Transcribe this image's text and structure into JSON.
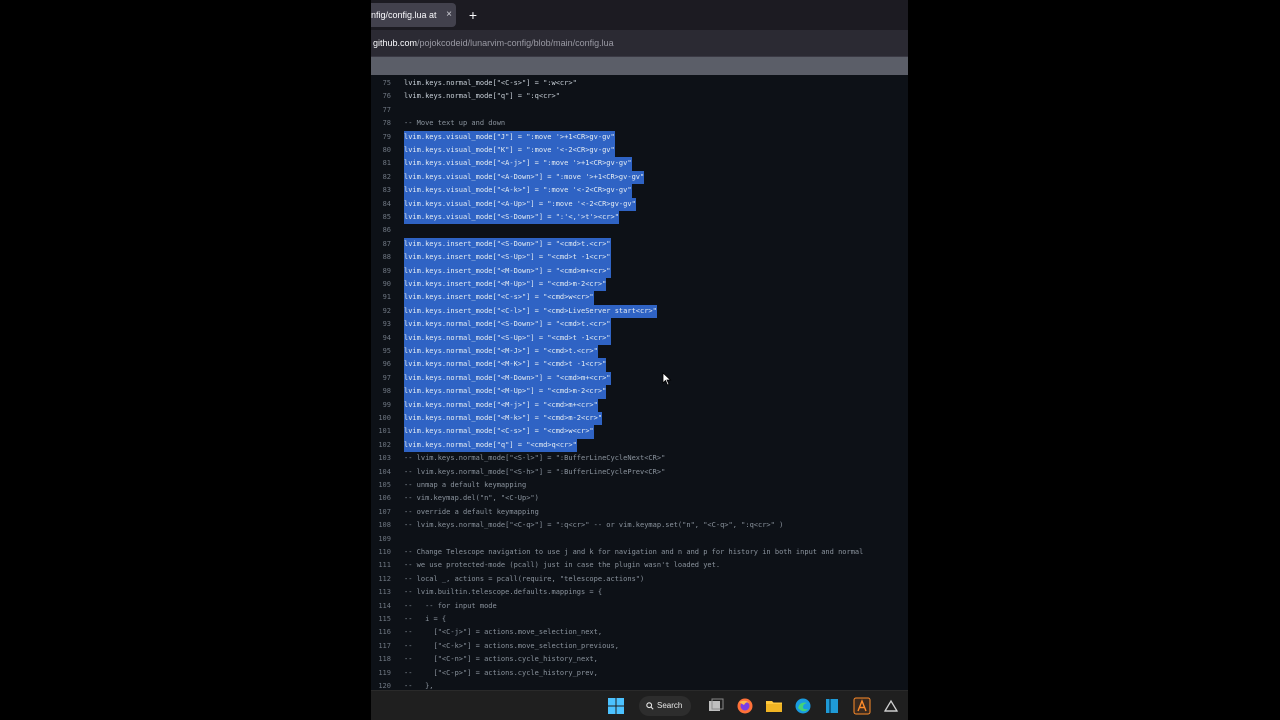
{
  "browser": {
    "tab_title": "nfig/config.lua at",
    "tab_close": "×",
    "new_tab": "+",
    "url_host": "github.com",
    "url_path": "/pojokcodeid/lunarvim-config/blob/main/config.lua"
  },
  "code": {
    "lines": [
      {
        "n": "75",
        "text": "lvim.keys.normal_mode[\"<C-s>\"] = \":w<cr>\"",
        "kind": "code"
      },
      {
        "n": "76",
        "text": "lvim.keys.normal_mode[\"q\"] = \":q<cr>\"",
        "kind": "code"
      },
      {
        "n": "77",
        "text": "",
        "kind": "code"
      },
      {
        "n": "78",
        "text": "-- Move text up and down",
        "kind": "comment"
      },
      {
        "n": "79",
        "text": "lvim.keys.visual_mode[\"J\"] = \":move '>+1<CR>gv-gv\"",
        "kind": "selected"
      },
      {
        "n": "80",
        "text": "lvim.keys.visual_mode[\"K\"] = \":move '<-2<CR>gv-gv\"",
        "kind": "selected"
      },
      {
        "n": "81",
        "text": "lvim.keys.visual_mode[\"<A-j>\"] = \":move '>+1<CR>gv-gv\"",
        "kind": "selected"
      },
      {
        "n": "82",
        "text": "lvim.keys.visual_mode[\"<A-Down>\"] = \":move '>+1<CR>gv-gv\"",
        "kind": "selected"
      },
      {
        "n": "83",
        "text": "lvim.keys.visual_mode[\"<A-k>\"] = \":move '<-2<CR>gv-gv\"",
        "kind": "selected"
      },
      {
        "n": "84",
        "text": "lvim.keys.visual_mode[\"<A-Up>\"] = \":move '<-2<CR>gv-gv\"",
        "kind": "selected"
      },
      {
        "n": "85",
        "text": "lvim.keys.visual_mode[\"<S-Down>\"] = \":'<,'>t'><cr>\"",
        "kind": "selected"
      },
      {
        "n": "86",
        "text": "",
        "kind": "code"
      },
      {
        "n": "87",
        "text": "lvim.keys.insert_mode[\"<S-Down>\"] = \"<cmd>t.<cr>\"",
        "kind": "selected"
      },
      {
        "n": "88",
        "text": "lvim.keys.insert_mode[\"<S-Up>\"] = \"<cmd>t -1<cr>\"",
        "kind": "selected"
      },
      {
        "n": "89",
        "text": "lvim.keys.insert_mode[\"<M-Down>\"] = \"<cmd>m+<cr>\"",
        "kind": "selected"
      },
      {
        "n": "90",
        "text": "lvim.keys.insert_mode[\"<M-Up>\"] = \"<cmd>m-2<cr>\"",
        "kind": "selected"
      },
      {
        "n": "91",
        "text": "lvim.keys.insert_mode[\"<C-s>\"] = \"<cmd>w<cr>\"",
        "kind": "selected"
      },
      {
        "n": "92",
        "text": "lvim.keys.insert_mode[\"<C-l>\"] = \"<cmd>LiveServer start<cr>\"",
        "kind": "selected"
      },
      {
        "n": "93",
        "text": "lvim.keys.normal_mode[\"<S-Down>\"] = \"<cmd>t.<cr>\"",
        "kind": "selected"
      },
      {
        "n": "94",
        "text": "lvim.keys.normal_mode[\"<S-Up>\"] = \"<cmd>t -1<cr>\"",
        "kind": "selected"
      },
      {
        "n": "95",
        "text": "lvim.keys.normal_mode[\"<M-J>\"] = \"<cmd>t.<cr>\"",
        "kind": "selected"
      },
      {
        "n": "96",
        "text": "lvim.keys.normal_mode[\"<M-K>\"] = \"<cmd>t -1<cr>\"",
        "kind": "selected"
      },
      {
        "n": "97",
        "text": "lvim.keys.normal_mode[\"<M-Down>\"] = \"<cmd>m+<cr>\"",
        "kind": "selected"
      },
      {
        "n": "98",
        "text": "lvim.keys.normal_mode[\"<M-Up>\"] = \"<cmd>m-2<cr>\"",
        "kind": "selected"
      },
      {
        "n": "99",
        "text": "lvim.keys.normal_mode[\"<M-j>\"] = \"<cmd>m+<cr>\"",
        "kind": "selected"
      },
      {
        "n": "100",
        "text": "lvim.keys.normal_mode[\"<M-k>\"] = \"<cmd>m-2<cr>\"",
        "kind": "selected"
      },
      {
        "n": "101",
        "text": "lvim.keys.normal_mode[\"<C-s>\"] = \"<cmd>w<cr>\"",
        "kind": "selected"
      },
      {
        "n": "102",
        "text": "lvim.keys.normal_mode[\"q\"] = \"<cmd>q<cr>\"",
        "kind": "selected"
      },
      {
        "n": "103",
        "text": "-- lvim.keys.normal_mode[\"<S-l>\"] = \":BufferLineCycleNext<CR>\"",
        "kind": "comment"
      },
      {
        "n": "104",
        "text": "-- lvim.keys.normal_mode[\"<S-h>\"] = \":BufferLineCyclePrev<CR>\"",
        "kind": "comment"
      },
      {
        "n": "105",
        "text": "-- unmap a default keymapping",
        "kind": "comment"
      },
      {
        "n": "106",
        "text": "-- vim.keymap.del(\"n\", \"<C-Up>\")",
        "kind": "comment"
      },
      {
        "n": "107",
        "text": "-- override a default keymapping",
        "kind": "comment"
      },
      {
        "n": "108",
        "text": "-- lvim.keys.normal_mode[\"<C-q>\"] = \":q<cr>\" -- or vim.keymap.set(\"n\", \"<C-q>\", \":q<cr>\" )",
        "kind": "comment"
      },
      {
        "n": "109",
        "text": "",
        "kind": "code"
      },
      {
        "n": "110",
        "text": "-- Change Telescope navigation to use j and k for navigation and n and p for history in both input and normal",
        "kind": "comment"
      },
      {
        "n": "111",
        "text": "-- we use protected-mode (pcall) just in case the plugin wasn't loaded yet.",
        "kind": "comment"
      },
      {
        "n": "112",
        "text": "-- local _, actions = pcall(require, \"telescope.actions\")",
        "kind": "comment"
      },
      {
        "n": "113",
        "text": "-- lvim.builtin.telescope.defaults.mappings = {",
        "kind": "comment"
      },
      {
        "n": "114",
        "text": "--   -- for input mode",
        "kind": "comment"
      },
      {
        "n": "115",
        "text": "--   i = {",
        "kind": "comment"
      },
      {
        "n": "116",
        "text": "--     [\"<C-j>\"] = actions.move_selection_next,",
        "kind": "comment"
      },
      {
        "n": "117",
        "text": "--     [\"<C-k>\"] = actions.move_selection_previous,",
        "kind": "comment"
      },
      {
        "n": "118",
        "text": "--     [\"<C-n>\"] = actions.cycle_history_next,",
        "kind": "comment"
      },
      {
        "n": "119",
        "text": "--     [\"<C-p>\"] = actions.cycle_history_prev,",
        "kind": "comment"
      },
      {
        "n": "120",
        "text": "--   },",
        "kind": "comment"
      }
    ]
  },
  "taskbar": {
    "search_label": "Search",
    "icons": [
      "windows-start-icon",
      "search-icon",
      "task-view-icon",
      "firefox-icon",
      "file-explorer-icon",
      "edge-icon",
      "editor-icon",
      "app-icon",
      "system-tray-icon"
    ]
  },
  "colors": {
    "selection": "#2f63c4",
    "code_bg": "#0d1117",
    "text": "#c9d1d9",
    "comment": "#8b949e"
  }
}
